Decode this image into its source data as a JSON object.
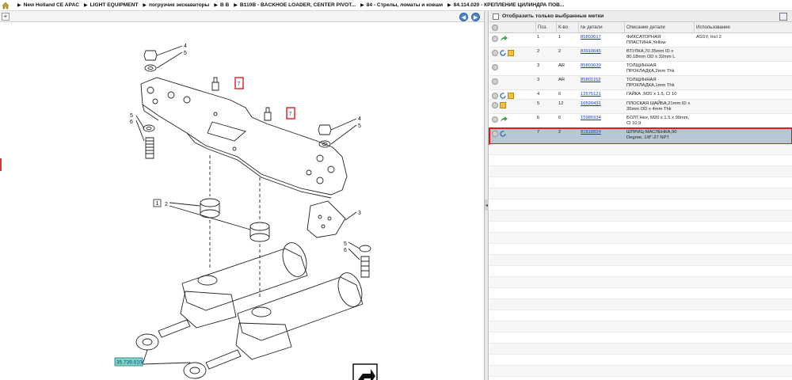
{
  "breadcrumb": {
    "items": [
      "New Holland CE APAC",
      "LIGHT EQUIPMENT",
      "погрузчик экскаваторы",
      "B B",
      "B110B - BACKHOE LOADER, CENTER PIVOT...",
      "84 - Стрелы, ломаты и ковши",
      "84.114.020 - КРЕПЛЕНИЕ ЦИЛИНДРА ПОВ..."
    ]
  },
  "toolbar": {
    "prev_label": "◀",
    "next_label": "▶",
    "expand_label": "+"
  },
  "filter": {
    "label": "Отобразить только выбранные метки"
  },
  "table": {
    "headers": [
      "Поз.",
      "К-во",
      "№ детали",
      "Описание детали",
      "Использование"
    ],
    "rows": [
      {
        "pos": "1",
        "qty": "1",
        "part": "85803617",
        "desc": "ФИКСАТОРНАЯ ПЛАСТИНА,Yellow",
        "usage": "ASSY, Incl 2",
        "icons": [
          "circle",
          "arrow"
        ]
      },
      {
        "pos": "2",
        "qty": "2",
        "part": "83910645",
        "desc": "ВТУЛКА,70.35mm ID x 80.18mm OD x 32mm L",
        "usage": "",
        "icons": [
          "circle",
          "refresh",
          "box"
        ]
      },
      {
        "pos": "3",
        "qty": "AR",
        "part": "85803639",
        "desc": "ТОЛЩИННАЯ ПРОКЛАДКА,2mm Thk",
        "usage": "",
        "icons": [
          "circle"
        ]
      },
      {
        "pos": "3",
        "qty": "AR",
        "part": "85801153",
        "desc": "ТОЛЩИННАЯ ПРОКЛАДКА,1mm Thk",
        "usage": "",
        "icons": [
          "circle"
        ]
      },
      {
        "pos": "4",
        "qty": "6",
        "part": "12575121",
        "desc": "ГАЙКА ,M20 x 1.5, Cl 10",
        "usage": "",
        "icons": [
          "circle",
          "refresh",
          "box"
        ]
      },
      {
        "pos": "5",
        "qty": "12",
        "part": "10520431",
        "desc": "ПЛОСКАЯ ШАЙБА,21mm ID x 35mm OD x 4mm Thk",
        "usage": "",
        "icons": [
          "circle",
          "box"
        ]
      },
      {
        "pos": "6",
        "qty": "6",
        "part": "15986934",
        "desc": "БОЛТ,Hex, M20 x 1.5 x 90mm, Cl 10.9",
        "usage": "",
        "icons": [
          "circle",
          "arrow"
        ]
      },
      {
        "pos": "7",
        "qty": "2",
        "part": "81818824",
        "desc": "ШПРИЦ-МАСЛЕНКА,90 Degree, 1/8\"-27 NPT",
        "usage": "",
        "icons": [
          "circle",
          "refresh"
        ]
      }
    ],
    "selected_index": 7
  },
  "diagram": {
    "callouts": [
      "1",
      "2",
      "3",
      "4",
      "5",
      "6",
      "7"
    ],
    "ref_label": "35.739.010",
    "colors": {
      "line": "#222222",
      "highlight": "#e01a1a",
      "ref_box": "#7fd6c8"
    }
  }
}
